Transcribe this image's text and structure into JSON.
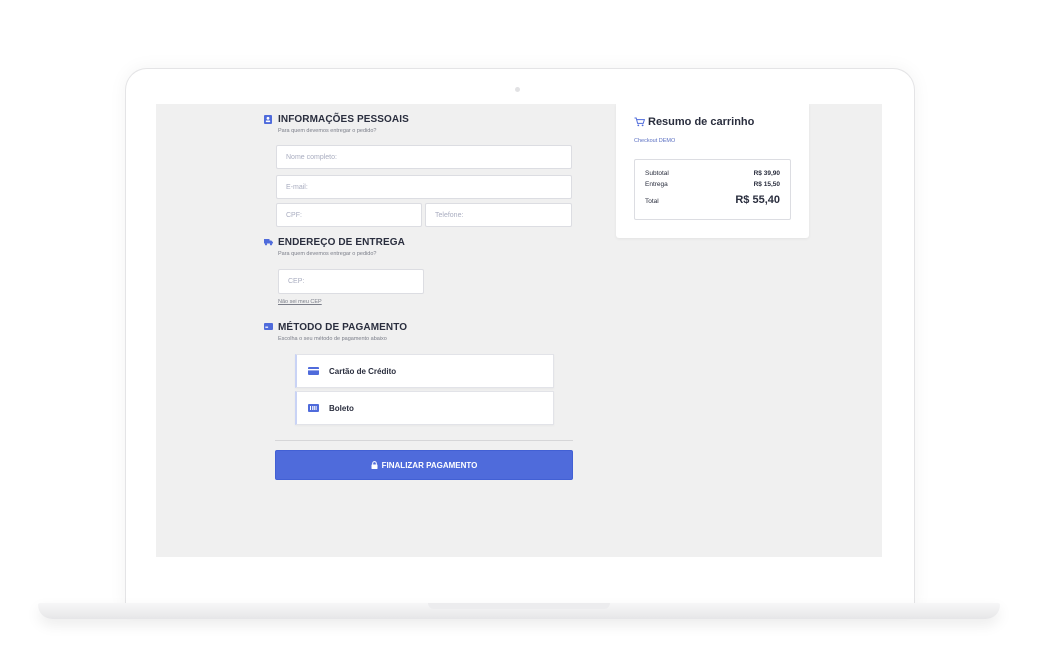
{
  "personal": {
    "title": "INFORMAÇÕES PESSOAIS",
    "subtitle": "Para quem devemos entregar o pedido?",
    "name_placeholder": "Nome completo:",
    "email_placeholder": "E-mail:",
    "cpf_placeholder": "CPF:",
    "phone_placeholder": "Telefone:",
    "icon": "id-card-icon"
  },
  "delivery": {
    "title": "ENDEREÇO DE ENTREGA",
    "subtitle": "Para quem devemos entregar o pedido?",
    "cep_placeholder": "CEP:",
    "cep_link": "Não sei meu CEP",
    "icon": "truck-icon"
  },
  "payment": {
    "title": "MÉTODO DE PAGAMENTO",
    "subtitle": "Escolha o seu método de pagamento abaixo",
    "options": [
      {
        "label": "Cartão de Crédito",
        "icon": "credit-card-icon"
      },
      {
        "label": "Boleto",
        "icon": "barcode-icon"
      }
    ],
    "button_label": "FINALIZAR PAGAMENTO",
    "icon": "card-icon"
  },
  "summary": {
    "title": "Resumo de carrinho",
    "subtitle": "Checkout DEMO",
    "subtotal_label": "Subtotal",
    "subtotal_value": "R$ 39,90",
    "delivery_label": "Entrega",
    "delivery_value": "R$ 15,50",
    "total_label": "Total",
    "total_value": "R$ 55,40",
    "icon": "cart-icon"
  },
  "colors": {
    "accent": "#4f6bdb",
    "text": "#2a2e3e",
    "background": "#f0f0f0"
  }
}
